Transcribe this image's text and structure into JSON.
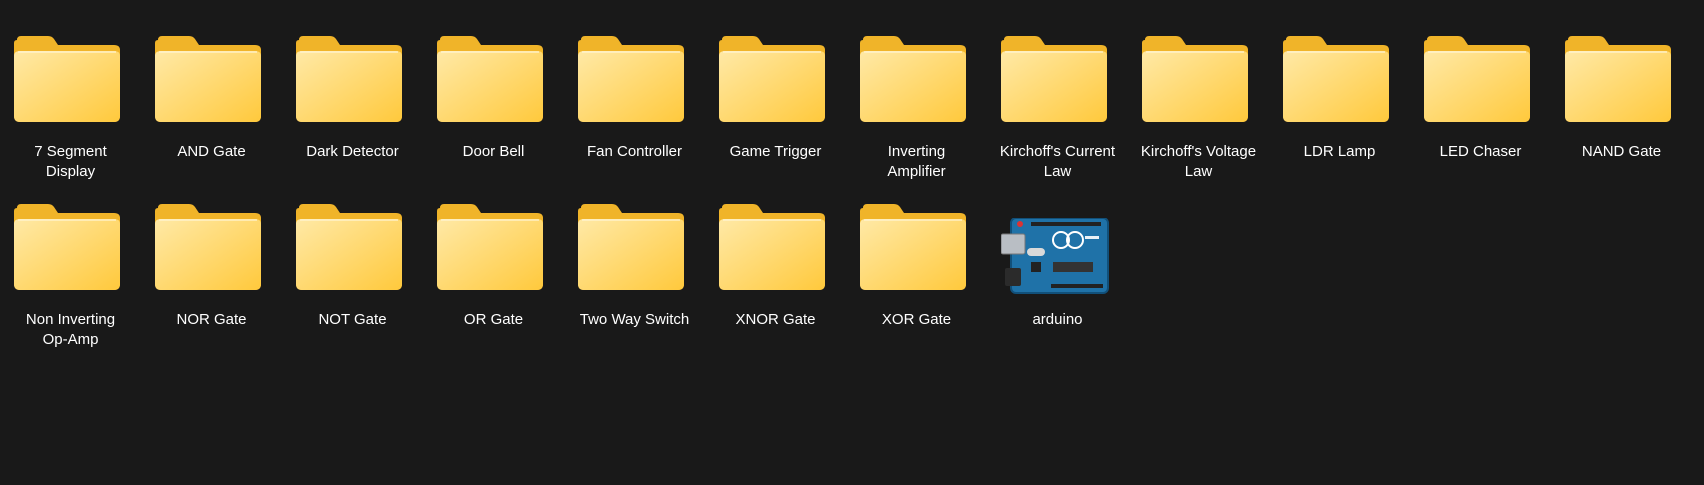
{
  "items": [
    {
      "label": "7 Segment\nDisplay",
      "icon": "folder-icon"
    },
    {
      "label": "AND Gate",
      "icon": "folder-icon"
    },
    {
      "label": "Dark Detector",
      "icon": "folder-icon"
    },
    {
      "label": "Door Bell",
      "icon": "folder-icon"
    },
    {
      "label": "Fan Controller",
      "icon": "folder-icon"
    },
    {
      "label": "Game Trigger",
      "icon": "folder-icon"
    },
    {
      "label": "Inverting\nAmplifier",
      "icon": "folder-icon"
    },
    {
      "label": "Kirchoff's Current\nLaw",
      "icon": "folder-icon"
    },
    {
      "label": "Kirchoff's Voltage\nLaw",
      "icon": "folder-icon"
    },
    {
      "label": "LDR Lamp",
      "icon": "folder-icon"
    },
    {
      "label": "LED Chaser",
      "icon": "folder-icon"
    },
    {
      "label": "NAND Gate",
      "icon": "folder-icon"
    },
    {
      "label": "Non Inverting\nOp-Amp",
      "icon": "folder-icon"
    },
    {
      "label": "NOR Gate",
      "icon": "folder-icon"
    },
    {
      "label": "NOT Gate",
      "icon": "folder-icon"
    },
    {
      "label": "OR Gate",
      "icon": "folder-icon"
    },
    {
      "label": "Two Way Switch",
      "icon": "folder-icon"
    },
    {
      "label": "XNOR Gate",
      "icon": "folder-icon"
    },
    {
      "label": "XOR Gate",
      "icon": "folder-icon"
    },
    {
      "label": "arduino",
      "icon": "arduino-board-icon"
    }
  ],
  "colors": {
    "background": "#191919",
    "folder_back": "#f0b429",
    "folder_front_light": "#ffe9a6",
    "folder_front_dark": "#ffc93c",
    "text": "#ffffff"
  }
}
